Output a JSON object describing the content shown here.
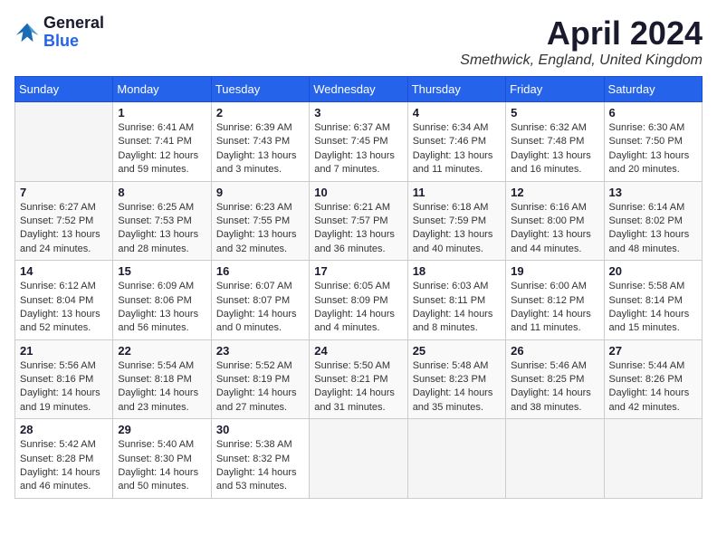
{
  "logo": {
    "general": "General",
    "blue": "Blue"
  },
  "header": {
    "month": "April 2024",
    "location": "Smethwick, England, United Kingdom"
  },
  "days_of_week": [
    "Sunday",
    "Monday",
    "Tuesday",
    "Wednesday",
    "Thursday",
    "Friday",
    "Saturday"
  ],
  "weeks": [
    [
      {
        "day": "",
        "sunrise": "",
        "sunset": "",
        "daylight": ""
      },
      {
        "day": "1",
        "sunrise": "Sunrise: 6:41 AM",
        "sunset": "Sunset: 7:41 PM",
        "daylight": "Daylight: 12 hours and 59 minutes."
      },
      {
        "day": "2",
        "sunrise": "Sunrise: 6:39 AM",
        "sunset": "Sunset: 7:43 PM",
        "daylight": "Daylight: 13 hours and 3 minutes."
      },
      {
        "day": "3",
        "sunrise": "Sunrise: 6:37 AM",
        "sunset": "Sunset: 7:45 PM",
        "daylight": "Daylight: 13 hours and 7 minutes."
      },
      {
        "day": "4",
        "sunrise": "Sunrise: 6:34 AM",
        "sunset": "Sunset: 7:46 PM",
        "daylight": "Daylight: 13 hours and 11 minutes."
      },
      {
        "day": "5",
        "sunrise": "Sunrise: 6:32 AM",
        "sunset": "Sunset: 7:48 PM",
        "daylight": "Daylight: 13 hours and 16 minutes."
      },
      {
        "day": "6",
        "sunrise": "Sunrise: 6:30 AM",
        "sunset": "Sunset: 7:50 PM",
        "daylight": "Daylight: 13 hours and 20 minutes."
      }
    ],
    [
      {
        "day": "7",
        "sunrise": "Sunrise: 6:27 AM",
        "sunset": "Sunset: 7:52 PM",
        "daylight": "Daylight: 13 hours and 24 minutes."
      },
      {
        "day": "8",
        "sunrise": "Sunrise: 6:25 AM",
        "sunset": "Sunset: 7:53 PM",
        "daylight": "Daylight: 13 hours and 28 minutes."
      },
      {
        "day": "9",
        "sunrise": "Sunrise: 6:23 AM",
        "sunset": "Sunset: 7:55 PM",
        "daylight": "Daylight: 13 hours and 32 minutes."
      },
      {
        "day": "10",
        "sunrise": "Sunrise: 6:21 AM",
        "sunset": "Sunset: 7:57 PM",
        "daylight": "Daylight: 13 hours and 36 minutes."
      },
      {
        "day": "11",
        "sunrise": "Sunrise: 6:18 AM",
        "sunset": "Sunset: 7:59 PM",
        "daylight": "Daylight: 13 hours and 40 minutes."
      },
      {
        "day": "12",
        "sunrise": "Sunrise: 6:16 AM",
        "sunset": "Sunset: 8:00 PM",
        "daylight": "Daylight: 13 hours and 44 minutes."
      },
      {
        "day": "13",
        "sunrise": "Sunrise: 6:14 AM",
        "sunset": "Sunset: 8:02 PM",
        "daylight": "Daylight: 13 hours and 48 minutes."
      }
    ],
    [
      {
        "day": "14",
        "sunrise": "Sunrise: 6:12 AM",
        "sunset": "Sunset: 8:04 PM",
        "daylight": "Daylight: 13 hours and 52 minutes."
      },
      {
        "day": "15",
        "sunrise": "Sunrise: 6:09 AM",
        "sunset": "Sunset: 8:06 PM",
        "daylight": "Daylight: 13 hours and 56 minutes."
      },
      {
        "day": "16",
        "sunrise": "Sunrise: 6:07 AM",
        "sunset": "Sunset: 8:07 PM",
        "daylight": "Daylight: 14 hours and 0 minutes."
      },
      {
        "day": "17",
        "sunrise": "Sunrise: 6:05 AM",
        "sunset": "Sunset: 8:09 PM",
        "daylight": "Daylight: 14 hours and 4 minutes."
      },
      {
        "day": "18",
        "sunrise": "Sunrise: 6:03 AM",
        "sunset": "Sunset: 8:11 PM",
        "daylight": "Daylight: 14 hours and 8 minutes."
      },
      {
        "day": "19",
        "sunrise": "Sunrise: 6:00 AM",
        "sunset": "Sunset: 8:12 PM",
        "daylight": "Daylight: 14 hours and 11 minutes."
      },
      {
        "day": "20",
        "sunrise": "Sunrise: 5:58 AM",
        "sunset": "Sunset: 8:14 PM",
        "daylight": "Daylight: 14 hours and 15 minutes."
      }
    ],
    [
      {
        "day": "21",
        "sunrise": "Sunrise: 5:56 AM",
        "sunset": "Sunset: 8:16 PM",
        "daylight": "Daylight: 14 hours and 19 minutes."
      },
      {
        "day": "22",
        "sunrise": "Sunrise: 5:54 AM",
        "sunset": "Sunset: 8:18 PM",
        "daylight": "Daylight: 14 hours and 23 minutes."
      },
      {
        "day": "23",
        "sunrise": "Sunrise: 5:52 AM",
        "sunset": "Sunset: 8:19 PM",
        "daylight": "Daylight: 14 hours and 27 minutes."
      },
      {
        "day": "24",
        "sunrise": "Sunrise: 5:50 AM",
        "sunset": "Sunset: 8:21 PM",
        "daylight": "Daylight: 14 hours and 31 minutes."
      },
      {
        "day": "25",
        "sunrise": "Sunrise: 5:48 AM",
        "sunset": "Sunset: 8:23 PM",
        "daylight": "Daylight: 14 hours and 35 minutes."
      },
      {
        "day": "26",
        "sunrise": "Sunrise: 5:46 AM",
        "sunset": "Sunset: 8:25 PM",
        "daylight": "Daylight: 14 hours and 38 minutes."
      },
      {
        "day": "27",
        "sunrise": "Sunrise: 5:44 AM",
        "sunset": "Sunset: 8:26 PM",
        "daylight": "Daylight: 14 hours and 42 minutes."
      }
    ],
    [
      {
        "day": "28",
        "sunrise": "Sunrise: 5:42 AM",
        "sunset": "Sunset: 8:28 PM",
        "daylight": "Daylight: 14 hours and 46 minutes."
      },
      {
        "day": "29",
        "sunrise": "Sunrise: 5:40 AM",
        "sunset": "Sunset: 8:30 PM",
        "daylight": "Daylight: 14 hours and 50 minutes."
      },
      {
        "day": "30",
        "sunrise": "Sunrise: 5:38 AM",
        "sunset": "Sunset: 8:32 PM",
        "daylight": "Daylight: 14 hours and 53 minutes."
      },
      {
        "day": "",
        "sunrise": "",
        "sunset": "",
        "daylight": ""
      },
      {
        "day": "",
        "sunrise": "",
        "sunset": "",
        "daylight": ""
      },
      {
        "day": "",
        "sunrise": "",
        "sunset": "",
        "daylight": ""
      },
      {
        "day": "",
        "sunrise": "",
        "sunset": "",
        "daylight": ""
      }
    ]
  ]
}
